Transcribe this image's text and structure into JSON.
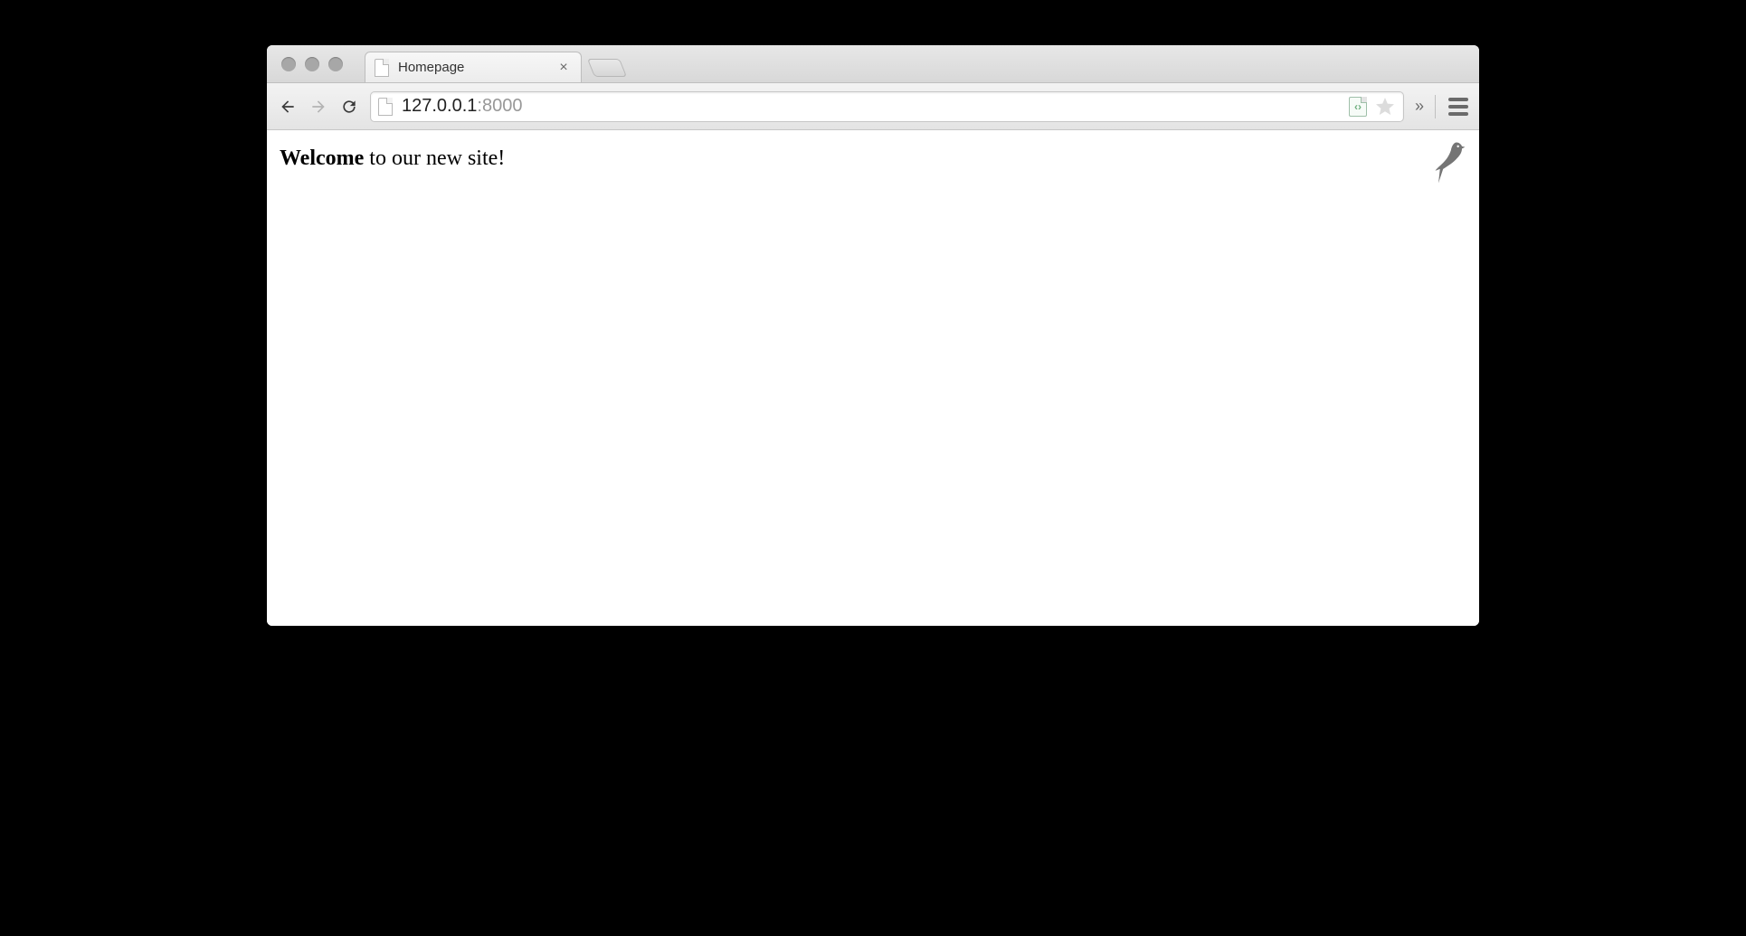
{
  "tab": {
    "title": "Homepage"
  },
  "address": {
    "host": "127.0.0.1",
    "port": ":8000"
  },
  "devtools_label": "‹›",
  "overflow_label": "»",
  "page": {
    "welcome_bold": "Welcome",
    "welcome_rest": " to our new site!"
  }
}
